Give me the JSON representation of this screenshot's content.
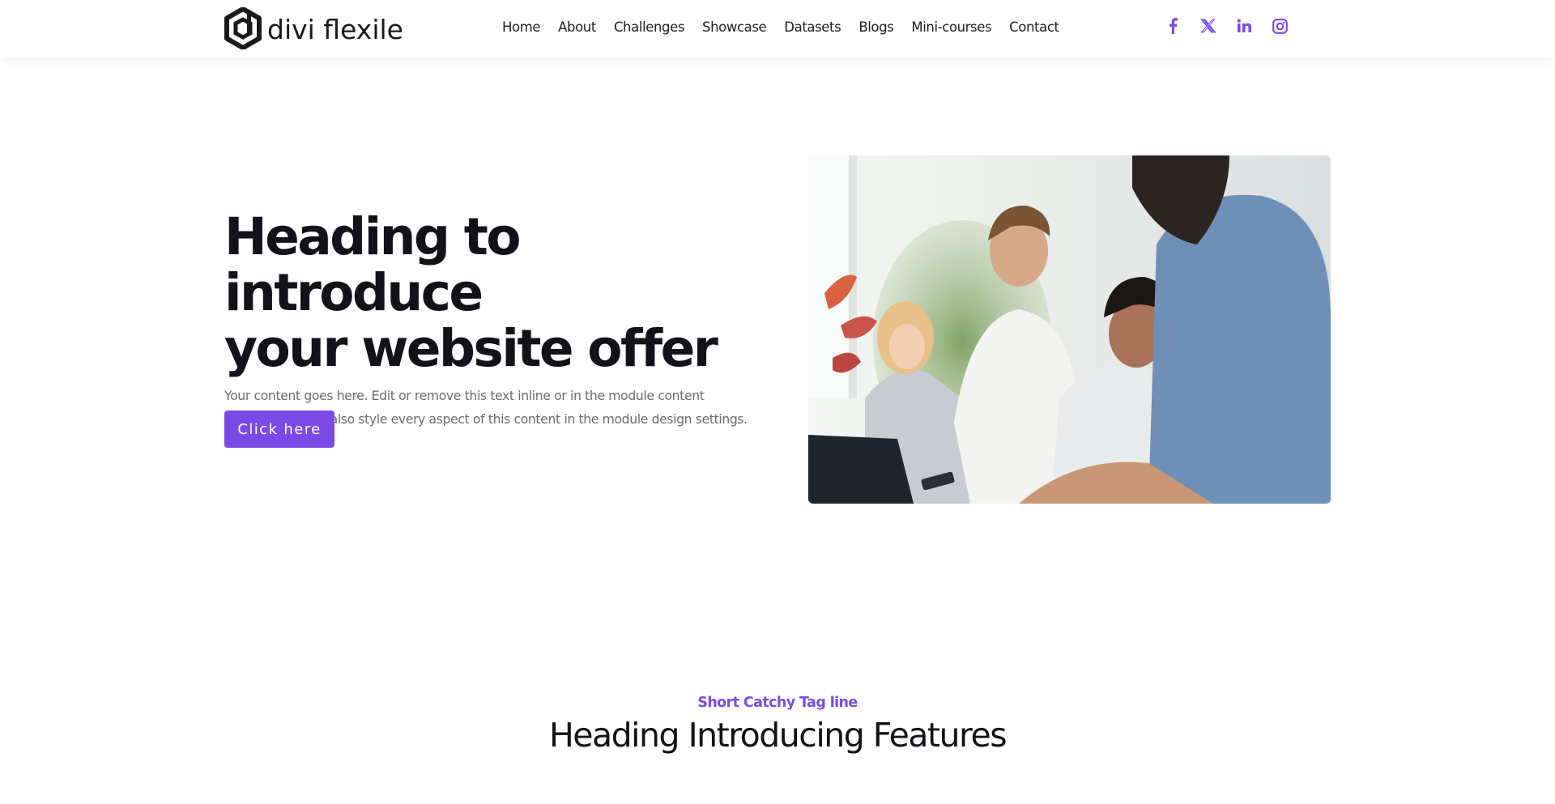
{
  "header": {
    "logo_text": "divi flexile",
    "nav": [
      "Home",
      "About",
      "Challenges",
      "Showcase",
      "Datasets",
      "Blogs",
      "Mini-courses",
      "Contact"
    ],
    "social": [
      {
        "name": "facebook-icon"
      },
      {
        "name": "x-twitter-icon"
      },
      {
        "name": "linkedin-icon"
      },
      {
        "name": "instagram-icon"
      }
    ]
  },
  "hero": {
    "title_line1": "Heading to introduce",
    "title_line2": "your website offer",
    "body": "Your content goes here. Edit or remove this text inline or in the module content settings. You can also style every aspect of this content in the module design settings.",
    "cta_label": "Click here",
    "image_alt": "Team of four colleagues smiling around a laptop in an office"
  },
  "features": {
    "tagline": "Short Catchy Tag line",
    "title": "Heading Introducing Features"
  },
  "colors": {
    "accent": "#7b4ae8",
    "heading": "#111318",
    "body_text": "#6b6b6b"
  }
}
